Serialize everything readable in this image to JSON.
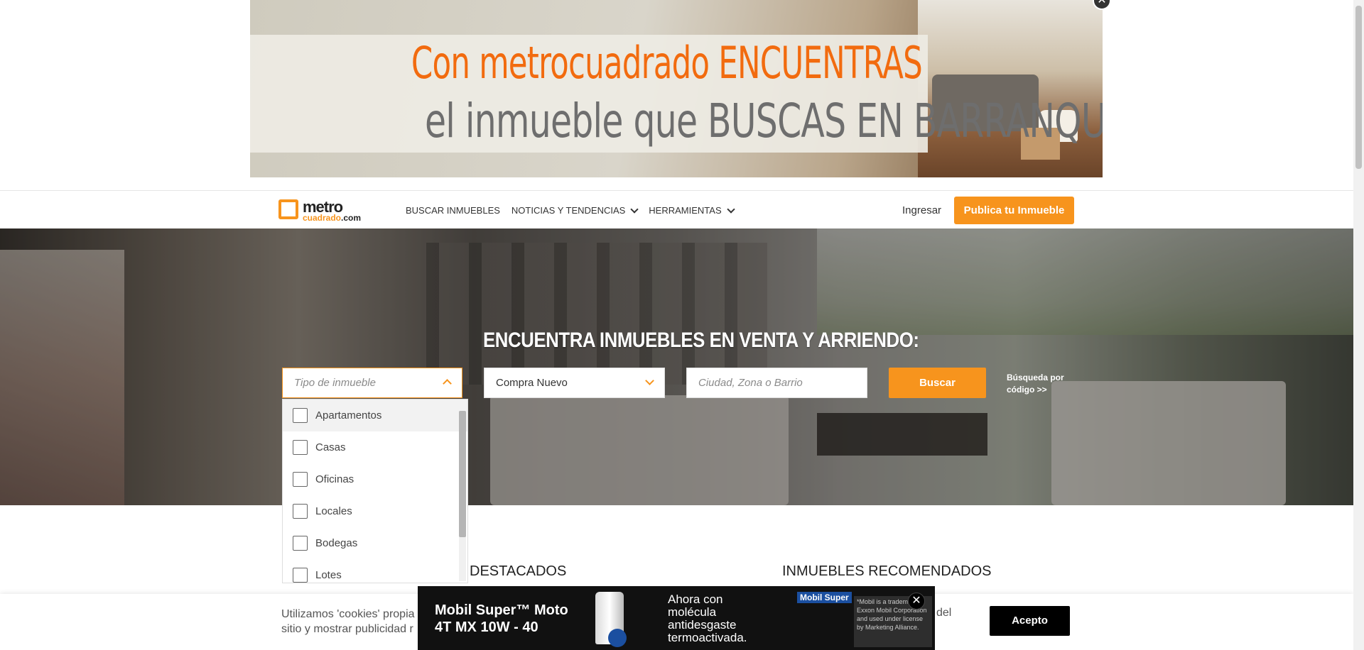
{
  "ad_banner": {
    "line1": "Con metrocuadrado ENCUENTRAS",
    "line2": "el inmueble que BUSCAS EN BARRANQUILLA",
    "close": "✕"
  },
  "header": {
    "logo_word": "metro",
    "logo_sub": "cuadrado",
    "logo_tld": ".com",
    "nav": [
      {
        "label": "BUSCAR INMUEBLES"
      },
      {
        "label": "NOTICIAS Y TENDENCIAS"
      },
      {
        "label": "HERRAMIENTAS"
      }
    ],
    "login": "Ingresar",
    "publish": "Publica tu Inmueble"
  },
  "hero": {
    "title": "ENCUENTRA INMUEBLES EN VENTA Y ARRIENDO:",
    "property_type_placeholder": "Tipo de inmueble",
    "deal_type_value": "Compra Nuevo",
    "location_placeholder": "Ciudad, Zona o Barrio",
    "search_button": "Buscar",
    "code_search_line1": "Búsqueda por",
    "code_search_line2": "código  >>"
  },
  "dropdown": {
    "options": [
      "Apartamentos",
      "Casas",
      "Oficinas",
      "Locales",
      "Bodegas",
      "Lotes"
    ]
  },
  "sections": {
    "destacados": "DESTACADOS",
    "recomendados": "INMUEBLES RECOMENDADOS"
  },
  "cookie": {
    "text_line1": "Utilizamos 'cookies' propia",
    "text_line2": "sitio y mostrar publicidad r",
    "text_tail": "del",
    "accept": "Acepto"
  },
  "mobil_ad": {
    "product_line1": "Mobil Super™ Moto",
    "product_line2": "4T MX 10W - 40",
    "copy_line1": "Ahora con",
    "copy_line2": "molécula",
    "copy_line3": "antidesgaste",
    "copy_line4": "termoactivada.",
    "brand": "Mobil Super",
    "fine_print": "*Mobil is a trademark of Exxon Mobil Corporation and used under license by Marketing Alliance.",
    "close": "✕"
  },
  "colors": {
    "accent_orange": "#f7941d",
    "ad_orange": "#f26b0f",
    "accept_black": "#000000"
  }
}
